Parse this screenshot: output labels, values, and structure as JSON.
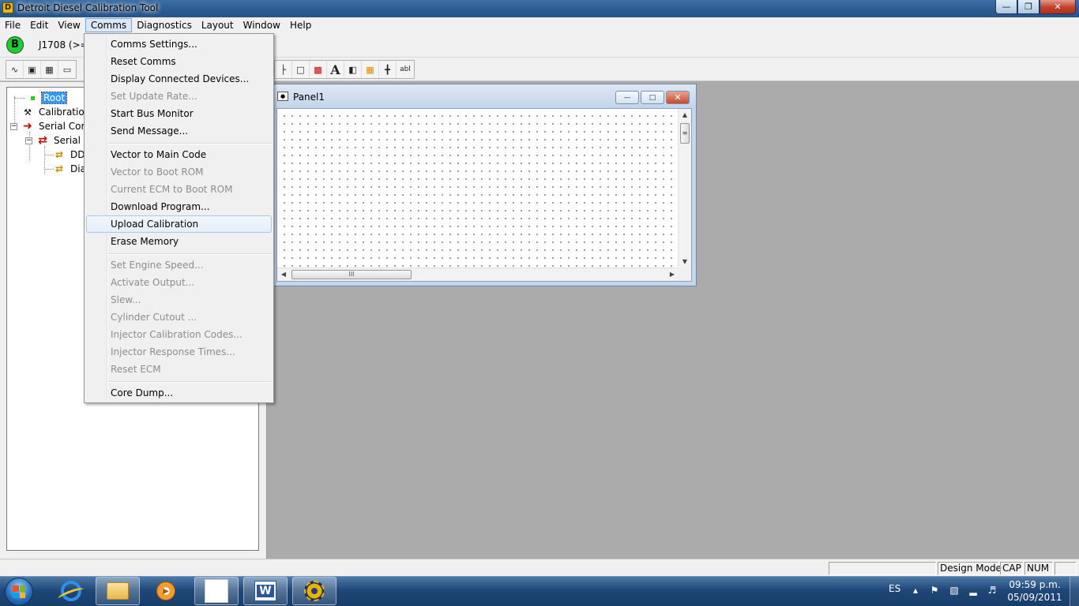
{
  "window": {
    "title": "Detroit Diesel Calibration Tool",
    "app_icon_letter": "D",
    "minimize_icon": "minimize-icon",
    "maximize_icon": "maximize-icon",
    "close_icon": "close-icon"
  },
  "menubar": {
    "items": [
      "File",
      "Edit",
      "View",
      "Comms",
      "Diagnostics",
      "Layout",
      "Window",
      "Help"
    ],
    "active": "Comms"
  },
  "toolbar": {
    "bus_indicator": "B",
    "bus_label": "J1708 (>=3"
  },
  "comms_menu": {
    "items": [
      {
        "label": "Comms Settings...",
        "enabled": true
      },
      {
        "label": "Reset Comms",
        "enabled": true
      },
      {
        "label": "Display Connected Devices...",
        "enabled": true
      },
      {
        "label": "Set Update Rate...",
        "enabled": false
      },
      {
        "label": "Start Bus Monitor",
        "enabled": true
      },
      {
        "label": "Send Message...",
        "enabled": true
      },
      {
        "label": "Vector to Main Code",
        "enabled": true
      },
      {
        "label": "Vector to Boot ROM",
        "enabled": false
      },
      {
        "label": "Current ECM to Boot ROM",
        "enabled": false
      },
      {
        "label": "Download Program...",
        "enabled": true
      },
      {
        "label": "Upload Calibration",
        "enabled": true,
        "highlighted": true
      },
      {
        "label": "Erase Memory",
        "enabled": true
      },
      {
        "label": "Set Engine Speed...",
        "enabled": false
      },
      {
        "label": "Activate Output...",
        "enabled": false
      },
      {
        "label": "Slew...",
        "enabled": false
      },
      {
        "label": "Cylinder Cutout ...",
        "enabled": false
      },
      {
        "label": "Injector Calibration Codes...",
        "enabled": false
      },
      {
        "label": "Injector Response Times...",
        "enabled": false
      },
      {
        "label": "Reset ECM",
        "enabled": false
      },
      {
        "label": "Core Dump...",
        "enabled": true
      }
    ]
  },
  "tree": {
    "items": [
      {
        "label": "Root",
        "selected": true
      },
      {
        "label": "Calibration"
      },
      {
        "label": "Serial Com"
      },
      {
        "label": "Serial C"
      },
      {
        "label": "DD"
      },
      {
        "label": "Dia"
      }
    ]
  },
  "panel": {
    "title": "Panel1",
    "scroll_grip": "III"
  },
  "statusbar": {
    "mode": "Design Mode",
    "cap": "CAP",
    "num": "NUM"
  },
  "taskbar": {
    "language": "ES",
    "time": "09:59 p.m.",
    "date": "05/09/2011"
  },
  "colors": {
    "selection": "#3399ff",
    "workspace": "#ababab",
    "menu_hover_border": "#a8c8ec"
  }
}
